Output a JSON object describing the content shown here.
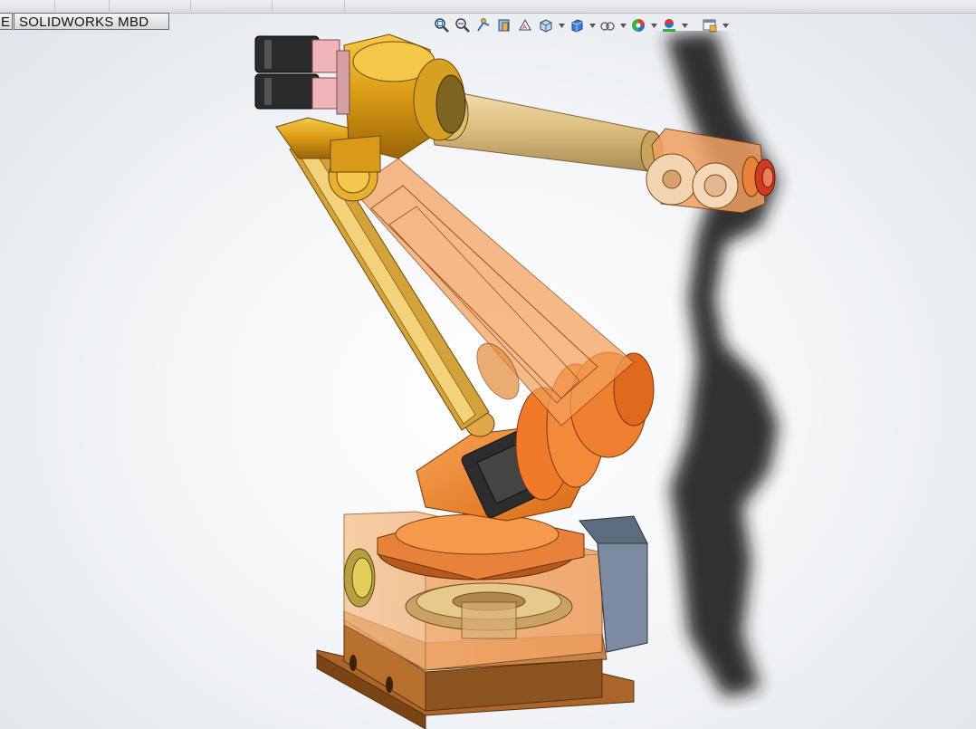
{
  "tabs": {
    "partial_tab": "E",
    "mbd_tab": "SOLIDWORKS MBD"
  },
  "heads_up_toolbar": [
    {
      "name": "zoom-to-fit-icon"
    },
    {
      "name": "zoom-to-area-icon"
    },
    {
      "name": "previous-view-icon"
    },
    {
      "name": "section-view-icon"
    },
    {
      "name": "dynamic-annotation-views-icon"
    },
    {
      "name": "view-orientation-icon"
    },
    {
      "name": "display-style-icon"
    },
    {
      "name": "hide-show-items-icon"
    },
    {
      "name": "edit-appearance-icon"
    },
    {
      "name": "apply-scene-icon"
    },
    {
      "name": "view-settings-icon"
    }
  ],
  "colors": {
    "robot_orange": "#f08a2a",
    "robot_gold": "#e0a020",
    "motor_black": "#2a2a2a",
    "shadow": "#1a1a1a",
    "base_bronze": "#b86a2c"
  }
}
